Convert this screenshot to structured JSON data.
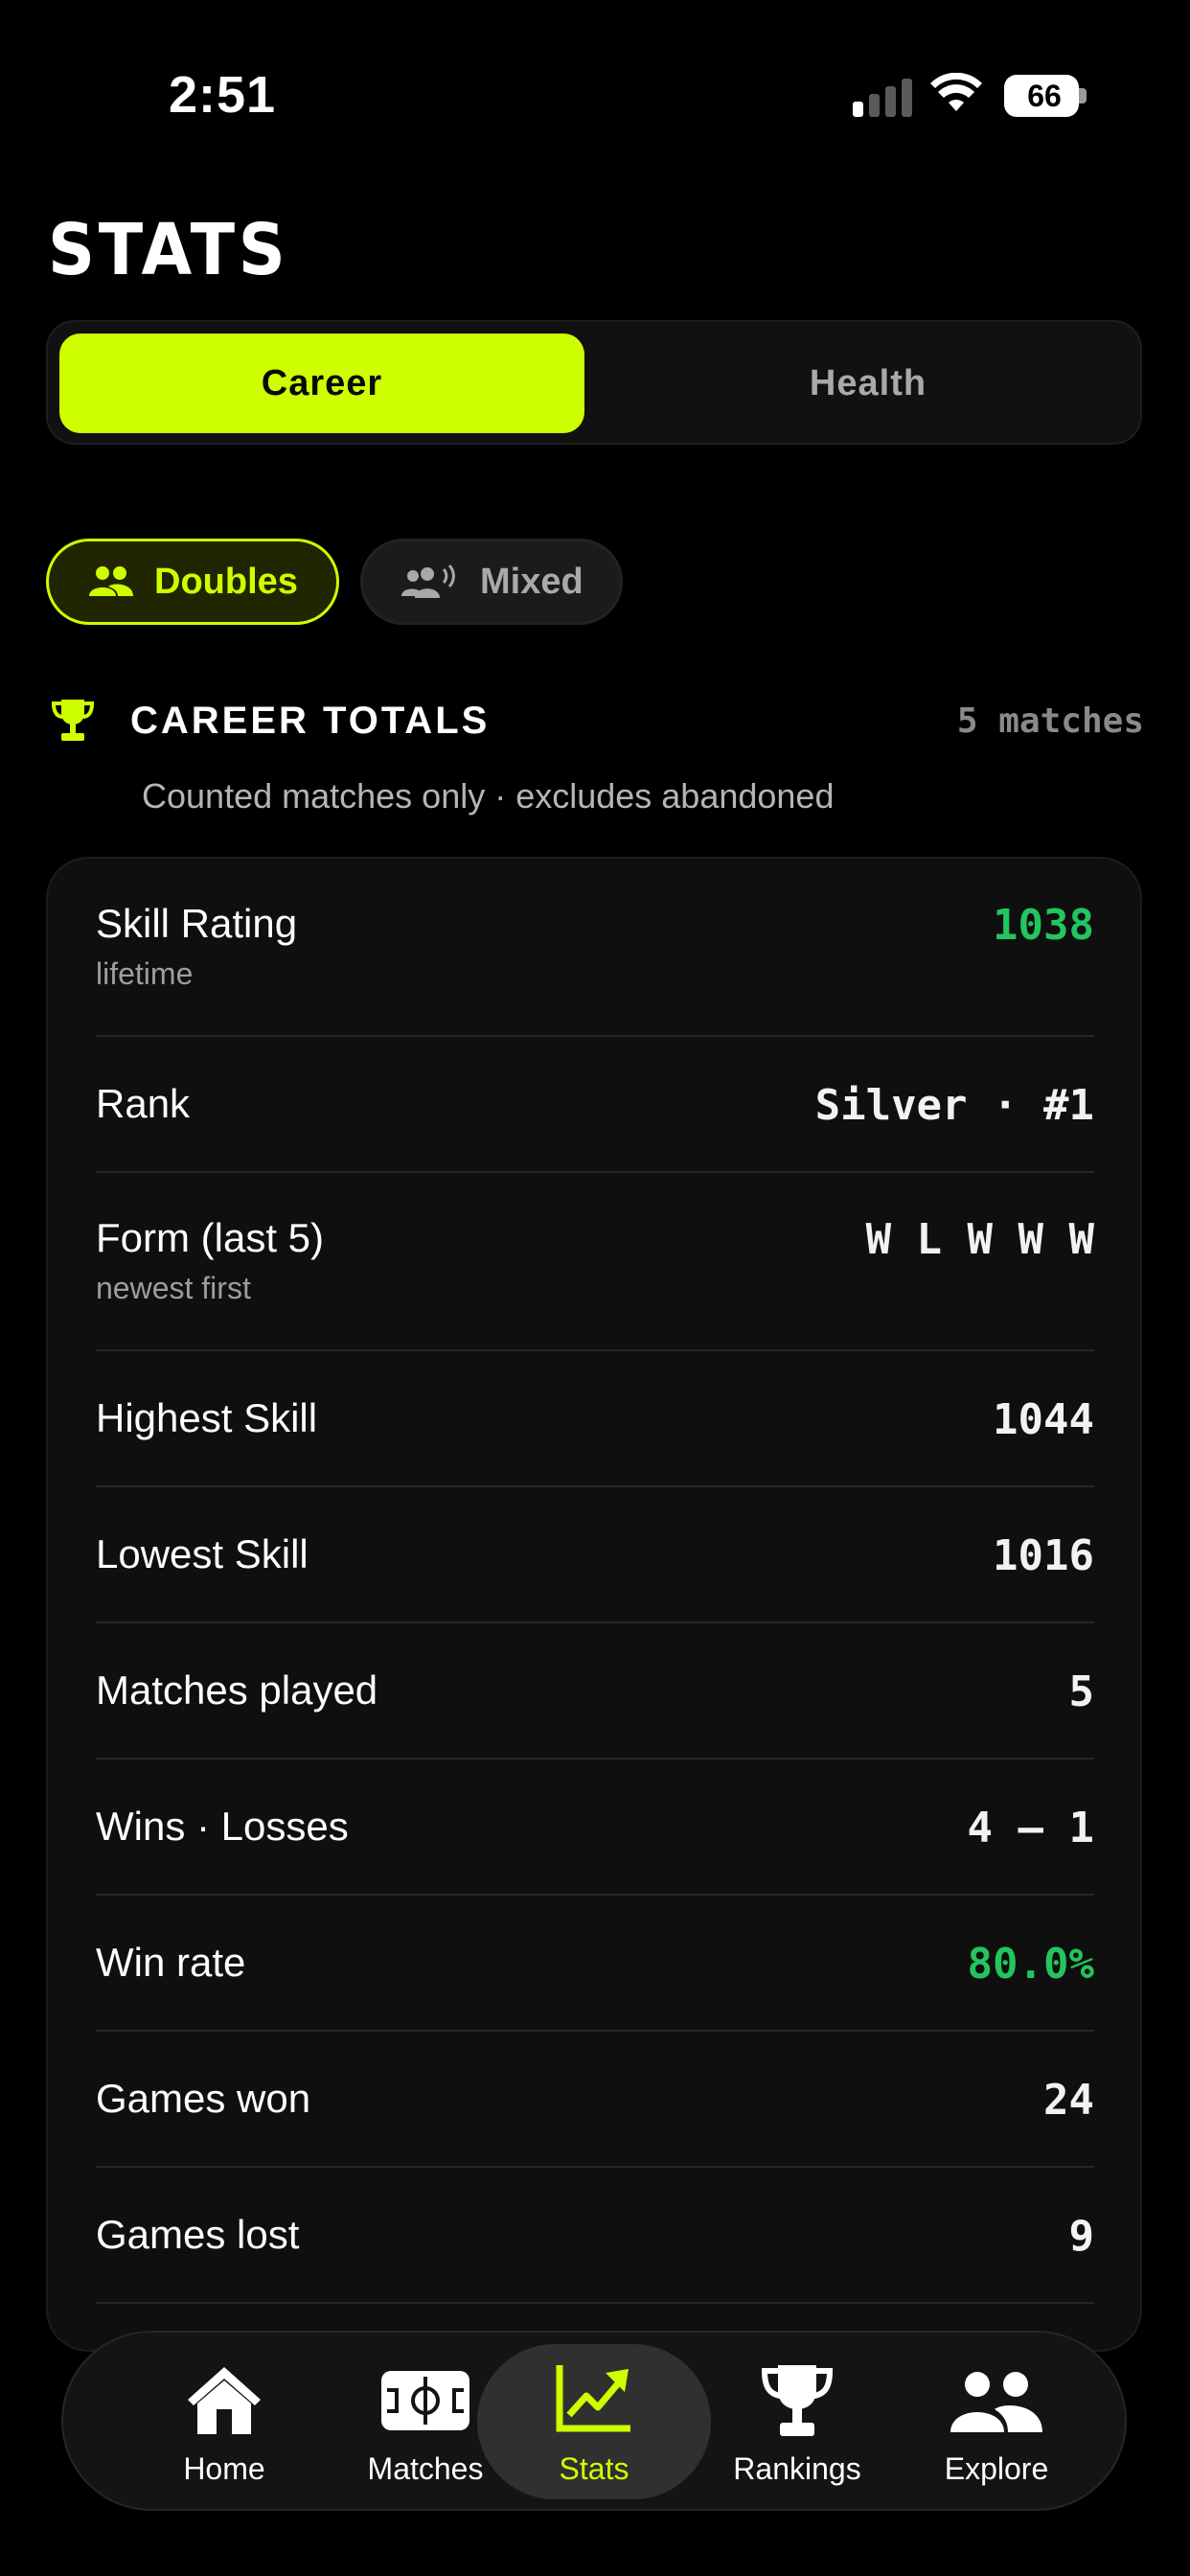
{
  "status_bar": {
    "time": "2:51",
    "battery": "66"
  },
  "header": {
    "title": "STATS"
  },
  "segments": {
    "career": "Career",
    "health": "Health"
  },
  "filters": {
    "doubles": "Doubles",
    "mixed": "Mixed"
  },
  "section": {
    "title": "CAREER TOTALS",
    "count": "5 matches",
    "subtitle": "Counted matches only · excludes abandoned"
  },
  "stats": [
    {
      "label": "Skill Rating",
      "sub": "lifetime",
      "value": "1038",
      "color": "#22c55e"
    },
    {
      "label": "Rank",
      "value": "Silver · #1"
    },
    {
      "label": "Form (last 5)",
      "sub": "newest first",
      "value": "W L W W W"
    },
    {
      "label": "Highest Skill",
      "value": "1044"
    },
    {
      "label": "Lowest Skill",
      "value": "1016"
    },
    {
      "label": "Matches played",
      "value": "5"
    },
    {
      "label": "Wins · Losses",
      "value": "4 — 1"
    },
    {
      "label": "Win rate",
      "value": "80.0%",
      "color": "#22c55e"
    },
    {
      "label": "Games won",
      "value": "24"
    },
    {
      "label": "Games lost",
      "value": "9"
    }
  ],
  "tabs": [
    {
      "label": "Home",
      "icon": "house-icon"
    },
    {
      "label": "Matches",
      "icon": "court-icon"
    },
    {
      "label": "Stats",
      "icon": "chart-trend-icon",
      "active": true
    },
    {
      "label": "Rankings",
      "icon": "trophy-icon"
    },
    {
      "label": "Explore",
      "icon": "people-icon"
    }
  ],
  "colors": {
    "accent": "#cdff00",
    "positive": "#22c55e",
    "background": "#000000"
  }
}
